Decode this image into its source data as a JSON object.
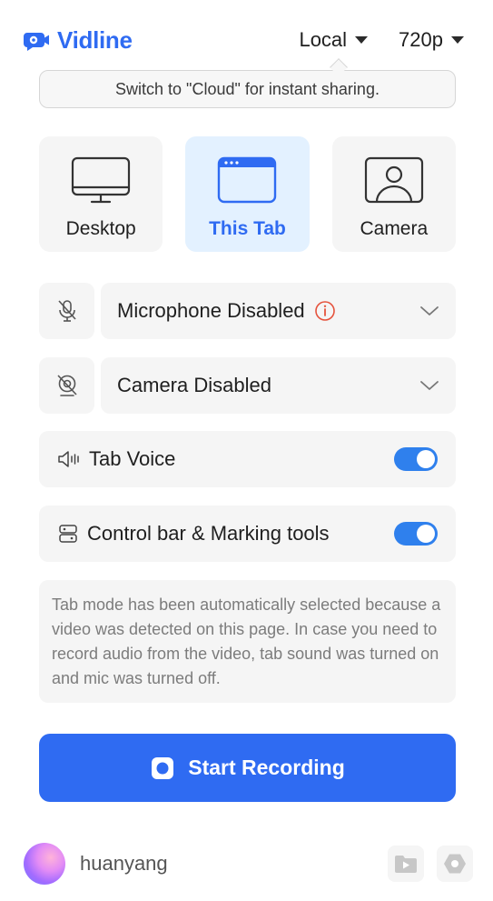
{
  "header": {
    "brand_name": "Vidline",
    "storage_select": "Local",
    "quality_select": "720p"
  },
  "tooltip": {
    "text": "Switch to \"Cloud\" for instant sharing."
  },
  "modes": [
    {
      "label": "Desktop",
      "icon": "desktop-icon",
      "active": false
    },
    {
      "label": "This Tab",
      "icon": "browser-tab-icon",
      "active": true
    },
    {
      "label": "Camera",
      "icon": "camera-user-icon",
      "active": false
    }
  ],
  "microphone": {
    "label": "Microphone Disabled",
    "icon": "mic-off-icon",
    "warning_icon": "info-icon"
  },
  "camera": {
    "label": "Camera Disabled",
    "icon": "camera-off-icon"
  },
  "tab_voice": {
    "label": "Tab Voice",
    "icon": "speaker-icon",
    "enabled": true
  },
  "control_bar": {
    "label": "Control bar & Marking tools",
    "icon": "toolbar-icon",
    "enabled": true
  },
  "notice": {
    "text": "Tab mode has been automatically selected because a video was detected on this page. In case you need to record audio from the video, tab sound was turned on and mic was turned off."
  },
  "start_button": {
    "label": "Start Recording",
    "icon": "record-icon"
  },
  "footer": {
    "username": "huanyang",
    "actions": [
      "folder-video-icon",
      "settings-icon"
    ]
  },
  "colors": {
    "accent": "#2f6bf2",
    "active_tile_bg": "#e3f1ff",
    "toggle_on": "#2f80ed",
    "warning": "#e5533d"
  }
}
